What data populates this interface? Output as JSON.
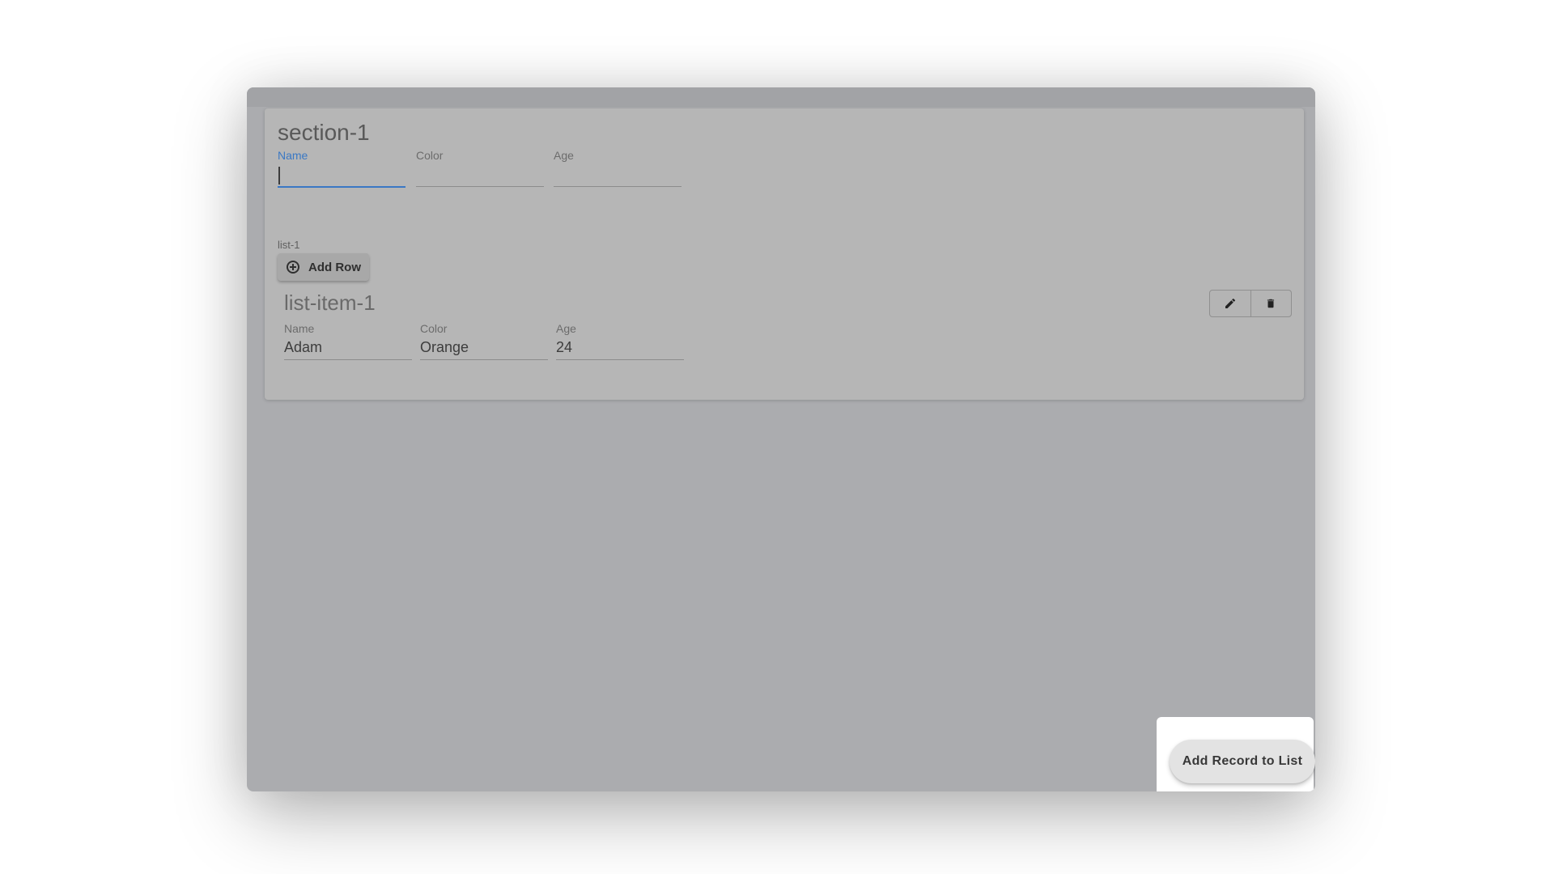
{
  "section": {
    "title": "section-1",
    "fields": {
      "name": {
        "label": "Name",
        "value": ""
      },
      "color": {
        "label": "Color",
        "value": ""
      },
      "age": {
        "label": "Age",
        "value": ""
      }
    }
  },
  "list": {
    "label": "list-1",
    "add_row_label": "Add Row",
    "items": [
      {
        "title": "list-item-1",
        "fields": {
          "name": {
            "label": "Name",
            "value": "Adam"
          },
          "color": {
            "label": "Color",
            "value": "Orange"
          },
          "age": {
            "label": "Age",
            "value": "24"
          }
        },
        "actions": [
          "pencil-icon",
          "trash-icon"
        ]
      }
    ]
  },
  "fab": {
    "label": "Add Record to List"
  },
  "colors": {
    "accent": "#3a78c4",
    "overlay": "#abacaf"
  }
}
